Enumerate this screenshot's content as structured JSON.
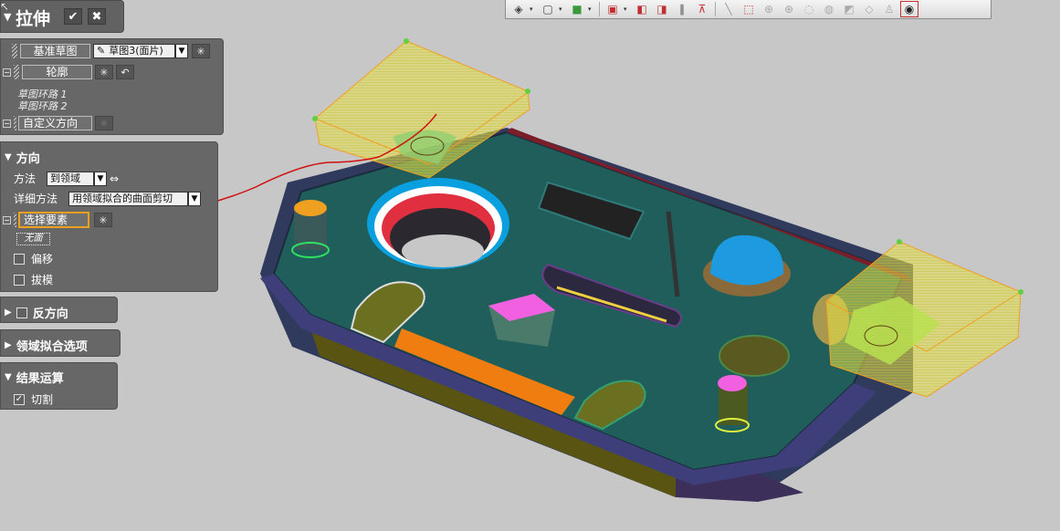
{
  "dialog": {
    "title": "拉伸",
    "ok_icon": "check-icon",
    "cancel_icon": "close-icon"
  },
  "sketch": {
    "base_label": "基准草图",
    "base_value": "草图3(面片)",
    "contour_label": "轮廓",
    "loops": [
      "草图环路 1",
      "草图环路 2"
    ],
    "custom_direction_label": "自定义方向"
  },
  "direction": {
    "title": "方向",
    "method_label": "方法",
    "method_value": "到领域",
    "detail_label": "详细方法",
    "detail_value": "用领域拟合的曲面剪切",
    "select_label": "选择要素",
    "select_value": "无面",
    "offset_label": "偏移",
    "draft_label": "拔模"
  },
  "reverse": {
    "title": "反方向"
  },
  "region_fit": {
    "title": "领域拟合选项"
  },
  "result": {
    "title": "结果运算",
    "cut_label": "切割",
    "cut_checked": true
  },
  "toolbar": {
    "icons": [
      "render-mode-icon",
      "cube-view-icon",
      "color-cube-icon",
      "section-view-icon",
      "plane-icon",
      "mirror-icon",
      "pattern-icon",
      "line-icon",
      "select-box-icon",
      "circle-icon",
      "circle-icon",
      "lasso-icon",
      "brush-icon",
      "draw-icon",
      "fill-icon",
      "person-icon",
      "eye-icon"
    ]
  }
}
